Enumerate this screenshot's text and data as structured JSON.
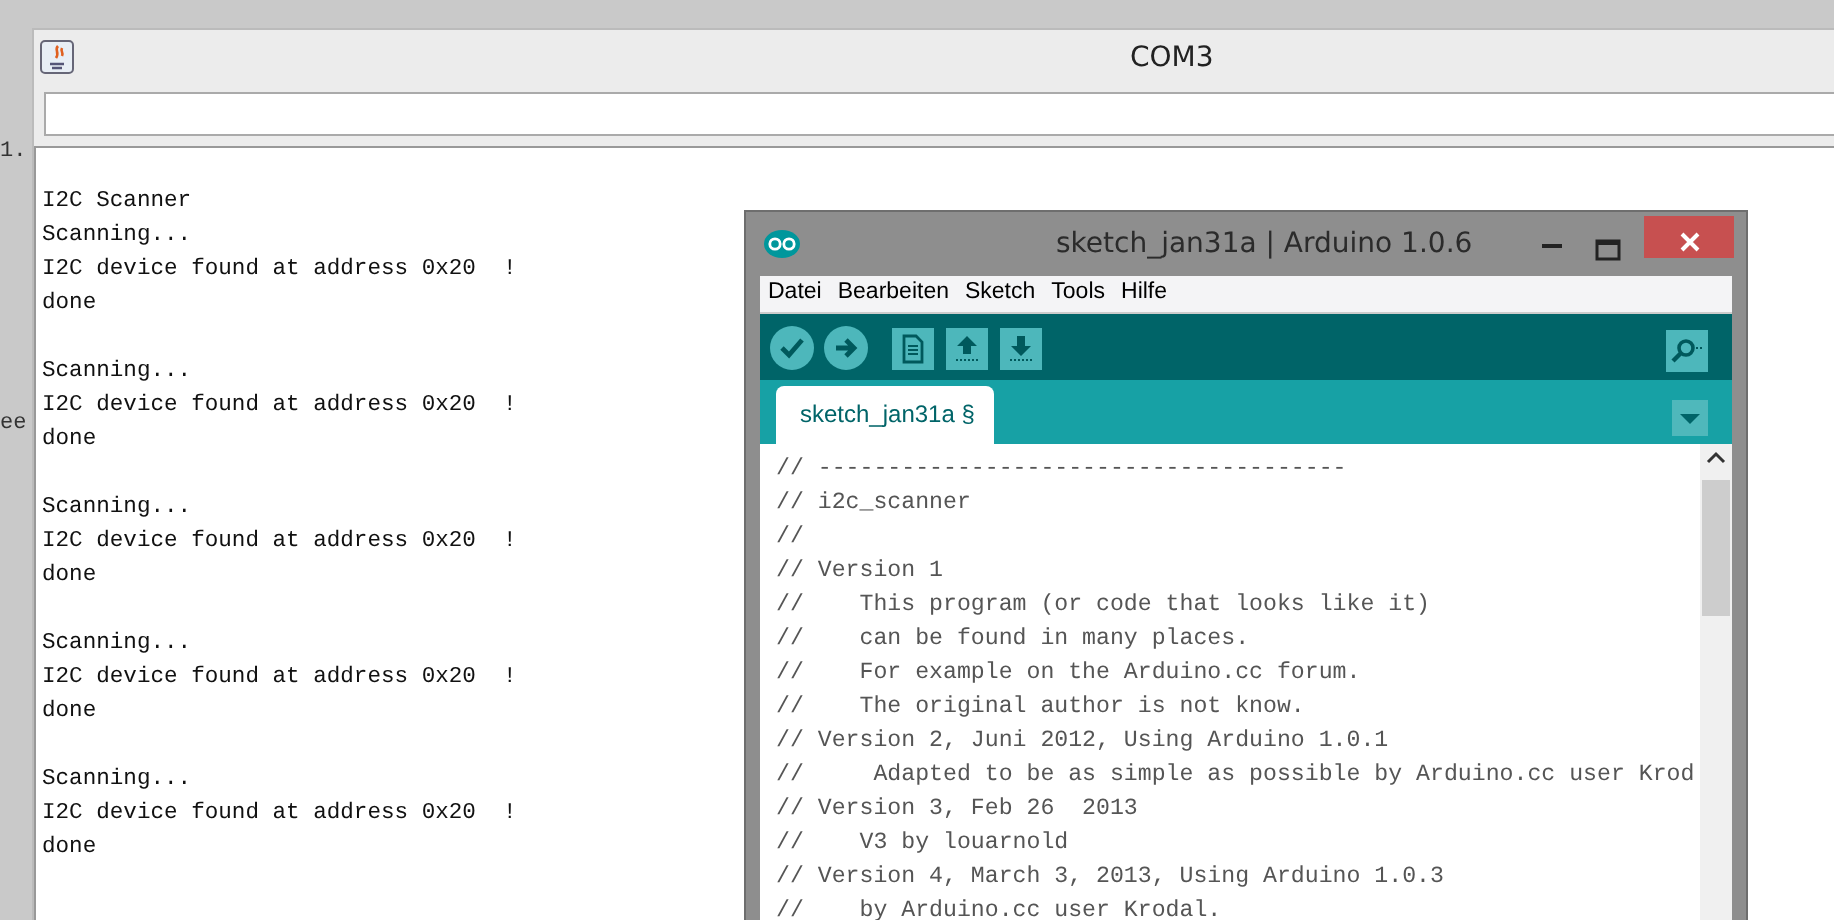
{
  "desktop": {
    "edge_texts": [
      "1.",
      "ee"
    ]
  },
  "serial_monitor": {
    "title": "COM3",
    "output_blocks": [
      [
        "I2C Scanner",
        "Scanning...",
        "I2C device found at address 0x20  !",
        "done"
      ],
      [
        "Scanning...",
        "I2C device found at address 0x20  !",
        "done"
      ],
      [
        "Scanning...",
        "I2C device found at address 0x20  !",
        "done"
      ],
      [
        "Scanning...",
        "I2C device found at address 0x20  !",
        "done"
      ],
      [
        "Scanning...",
        "I2C device found at address 0x20  !",
        "done"
      ]
    ]
  },
  "arduino": {
    "title": "sketch_jan31a | Arduino 1.0.6",
    "menu": [
      "Datei",
      "Bearbeiten",
      "Sketch",
      "Tools",
      "Hilfe"
    ],
    "toolbar": [
      {
        "kind": "verify"
      },
      {
        "kind": "upload"
      },
      {
        "kind": "new"
      },
      {
        "kind": "open"
      },
      {
        "kind": "save"
      },
      {
        "kind": "serial"
      }
    ],
    "tabs": [
      {
        "label": "sketch_jan31a §",
        "selected": true
      }
    ],
    "code_lines": [
      "// --------------------------------------",
      "// i2c_scanner",
      "//",
      "// Version 1",
      "//    This program (or code that looks like it)",
      "//    can be found in many places.",
      "//    For example on the Arduino.cc forum.",
      "//    The original author is not know.",
      "// Version 2, Juni 2012, Using Arduino 1.0.1",
      "//     Adapted to be as simple as possible by Arduino.cc user Krod",
      "// Version 3, Feb 26  2013",
      "//    V3 by louarnold",
      "// Version 4, March 3, 2013, Using Arduino 1.0.3",
      "//    by Arduino.cc user Krodal."
    ]
  }
}
